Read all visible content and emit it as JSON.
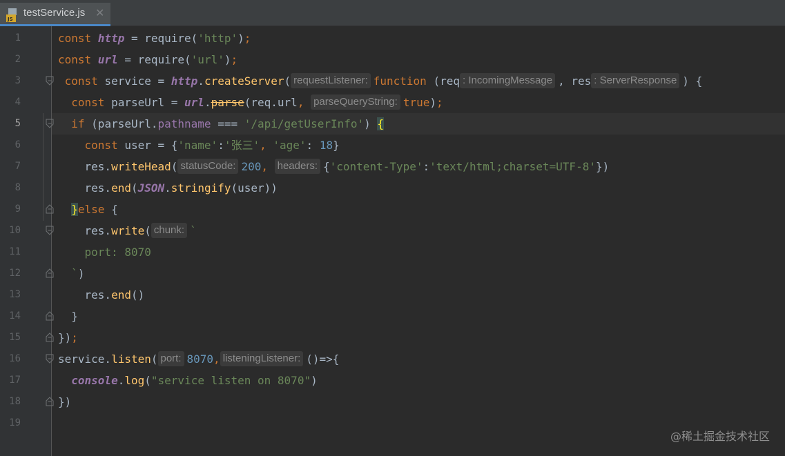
{
  "tab": {
    "filename": "testService.js",
    "close": "✕",
    "icon_label": "JS"
  },
  "watermark": "@稀土掘金技术社区",
  "colors": {
    "background": "#2b2b2b",
    "keyword": "#cc7832",
    "function": "#ffc66d",
    "string": "#6a8759",
    "number": "#6897bb",
    "global": "#9876aa"
  },
  "lines": [
    {
      "n": "1",
      "tokens": [
        {
          "t": "const ",
          "c": "kw"
        },
        {
          "t": "http",
          "c": "gv"
        },
        {
          "t": " = require("
        },
        {
          "t": "'http'",
          "c": "str"
        },
        {
          "t": ")"
        },
        {
          "t": ";",
          "c": "kw"
        }
      ]
    },
    {
      "n": "2",
      "tokens": [
        {
          "t": "const ",
          "c": "kw"
        },
        {
          "t": "url",
          "c": "gv"
        },
        {
          "t": " = require("
        },
        {
          "t": "'url'",
          "c": "str"
        },
        {
          "t": ")"
        },
        {
          "t": ";",
          "c": "kw"
        }
      ]
    },
    {
      "n": "3",
      "indent": " ",
      "fold": "open",
      "tokens": [
        {
          "t": "const ",
          "c": "kw"
        },
        {
          "t": "service = "
        },
        {
          "t": "http",
          "c": "gv"
        },
        {
          "t": "."
        },
        {
          "t": "createServer",
          "c": "fn"
        },
        {
          "t": "("
        },
        {
          "t": "requestListener:",
          "c": "hint"
        },
        {
          "t": "function ",
          "c": "kw"
        },
        {
          "t": "(req"
        },
        {
          "t": ": IncomingMessage",
          "c": "hint"
        },
        {
          "t": ", res"
        },
        {
          "t": ": ServerResponse",
          "c": "hint"
        },
        {
          "t": ") {"
        }
      ]
    },
    {
      "n": "4",
      "indent": "  ",
      "tokens": [
        {
          "t": "const ",
          "c": "kw"
        },
        {
          "t": "parseUrl = "
        },
        {
          "t": "url",
          "c": "gv"
        },
        {
          "t": "."
        },
        {
          "t": "parse",
          "c": "fn strike"
        },
        {
          "t": "(req.url"
        },
        {
          "t": ", ",
          "c": "kw"
        },
        {
          "t": "parseQueryString:",
          "c": "hint"
        },
        {
          "t": "true",
          "c": "kw"
        },
        {
          "t": ")"
        },
        {
          "t": ";",
          "c": "kw"
        }
      ]
    },
    {
      "n": "5",
      "indent": "  ",
      "fold": "open",
      "current": true,
      "tokens": [
        {
          "t": "if ",
          "c": "kw"
        },
        {
          "t": "(parseUrl."
        },
        {
          "t": "pathname",
          "c": "prop"
        },
        {
          "t": " === "
        },
        {
          "t": "'/api/getUserInfo'",
          "c": "str"
        },
        {
          "t": ") "
        },
        {
          "t": "{",
          "c": "brace"
        }
      ]
    },
    {
      "n": "6",
      "indent": "    ",
      "tokens": [
        {
          "t": "const ",
          "c": "kw"
        },
        {
          "t": "user = {"
        },
        {
          "t": "'name'",
          "c": "str"
        },
        {
          "t": ":"
        },
        {
          "t": "'张三'",
          "c": "str"
        },
        {
          "t": ", ",
          "c": "kw"
        },
        {
          "t": "'age'",
          "c": "str"
        },
        {
          "t": ": "
        },
        {
          "t": "18",
          "c": "num"
        },
        {
          "t": "}"
        }
      ]
    },
    {
      "n": "7",
      "indent": "    ",
      "tokens": [
        {
          "t": "res."
        },
        {
          "t": "writeHead",
          "c": "fn"
        },
        {
          "t": "("
        },
        {
          "t": "statusCode:",
          "c": "hint"
        },
        {
          "t": "200",
          "c": "num"
        },
        {
          "t": ", ",
          "c": "kw"
        },
        {
          "t": "headers:",
          "c": "hint"
        },
        {
          "t": "{"
        },
        {
          "t": "'content-Type'",
          "c": "str"
        },
        {
          "t": ":"
        },
        {
          "t": "'text/html;charset=UTF-8'",
          "c": "str"
        },
        {
          "t": "})"
        }
      ]
    },
    {
      "n": "8",
      "indent": "    ",
      "tokens": [
        {
          "t": "res."
        },
        {
          "t": "end",
          "c": "fn"
        },
        {
          "t": "("
        },
        {
          "t": "JSON",
          "c": "gv"
        },
        {
          "t": "."
        },
        {
          "t": "stringify",
          "c": "fn"
        },
        {
          "t": "(user))"
        }
      ]
    },
    {
      "n": "9",
      "indent": "  ",
      "fold": "close",
      "tokens": [
        {
          "t": "}",
          "c": "brace"
        },
        {
          "t": "else ",
          "c": "kw"
        },
        {
          "t": "{"
        }
      ]
    },
    {
      "n": "10",
      "indent": "    ",
      "fold": "open",
      "tokens": [
        {
          "t": "res."
        },
        {
          "t": "write",
          "c": "fn"
        },
        {
          "t": "("
        },
        {
          "t": "chunk:",
          "c": "hint"
        },
        {
          "t": "`",
          "c": "str"
        }
      ]
    },
    {
      "n": "11",
      "indent": "    ",
      "tokens": [
        {
          "t": "port: 8070",
          "c": "str"
        }
      ]
    },
    {
      "n": "12",
      "indent": "  ",
      "fold": "close",
      "tokens": [
        {
          "t": "`",
          "c": "str"
        },
        {
          "t": ")"
        }
      ]
    },
    {
      "n": "13",
      "indent": "    ",
      "tokens": [
        {
          "t": "res."
        },
        {
          "t": "end",
          "c": "fn"
        },
        {
          "t": "()"
        }
      ]
    },
    {
      "n": "14",
      "indent": "  ",
      "fold": "close",
      "tokens": [
        {
          "t": "}"
        }
      ]
    },
    {
      "n": "15",
      "fold": "close",
      "tokens": [
        {
          "t": "})"
        },
        {
          "t": ";",
          "c": "kw"
        }
      ]
    },
    {
      "n": "16",
      "fold": "open",
      "tokens": [
        {
          "t": "service."
        },
        {
          "t": "listen",
          "c": "fn"
        },
        {
          "t": "("
        },
        {
          "t": "port:",
          "c": "hint"
        },
        {
          "t": "8070",
          "c": "num"
        },
        {
          "t": ",",
          "c": "kw"
        },
        {
          "t": "listeningListener:",
          "c": "hint"
        },
        {
          "t": "()=>{"
        }
      ]
    },
    {
      "n": "17",
      "indent": "  ",
      "tokens": [
        {
          "t": "console",
          "c": "gv"
        },
        {
          "t": "."
        },
        {
          "t": "log",
          "c": "fn"
        },
        {
          "t": "("
        },
        {
          "t": "\"service listen on 8070\"",
          "c": "str"
        },
        {
          "t": ")"
        }
      ]
    },
    {
      "n": "18",
      "fold": "close",
      "tokens": [
        {
          "t": "})"
        }
      ]
    },
    {
      "n": "19",
      "tokens": []
    }
  ]
}
